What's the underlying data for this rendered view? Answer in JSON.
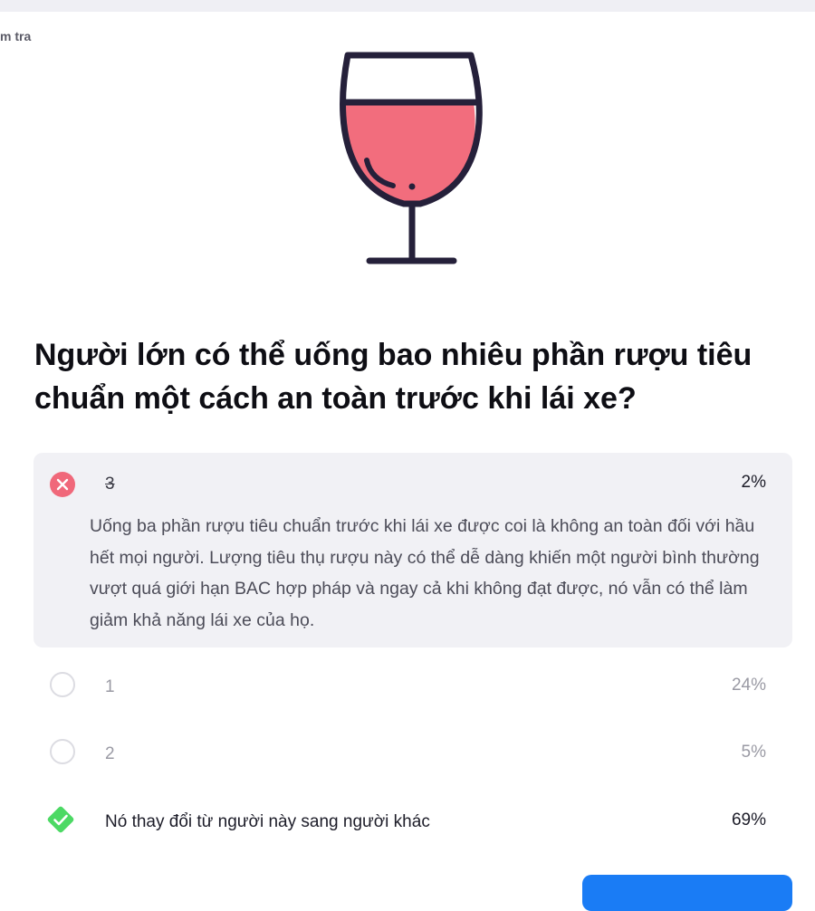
{
  "header": {
    "breadcrumb_fragment": "m tra"
  },
  "illustration": {
    "name": "wine-glass-icon",
    "fill_color": "#f26d7d",
    "stroke_color": "#25203a"
  },
  "question": {
    "text": "Người lớn có thể uống bao nhiêu phần rượu tiêu chuẩn một cách an toàn trước khi lái xe?"
  },
  "options": [
    {
      "label": "3",
      "percent": "2%",
      "state": "selected-wrong",
      "explanation": "Uống ba phần rượu tiêu chuẩn trước khi lái xe được coi là không an toàn đối với hầu hết mọi người. Lượng tiêu thụ rượu này có thể dễ dàng khiến một người bình thường vượt quá giới hạn BAC hợp pháp và ngay cả khi không đạt được, nó vẫn có thể làm giảm khả năng lái xe của họ."
    },
    {
      "label": "1",
      "percent": "24%",
      "state": "unselected"
    },
    {
      "label": "2",
      "percent": "5%",
      "state": "unselected"
    },
    {
      "label": "Nó thay đổi từ người này sang người khác",
      "percent": "69%",
      "state": "correct"
    }
  ],
  "colors": {
    "wrong": "#f0687a",
    "correct": "#4cd964",
    "card": "#f1f1f5",
    "button": "#1a7cf5"
  }
}
